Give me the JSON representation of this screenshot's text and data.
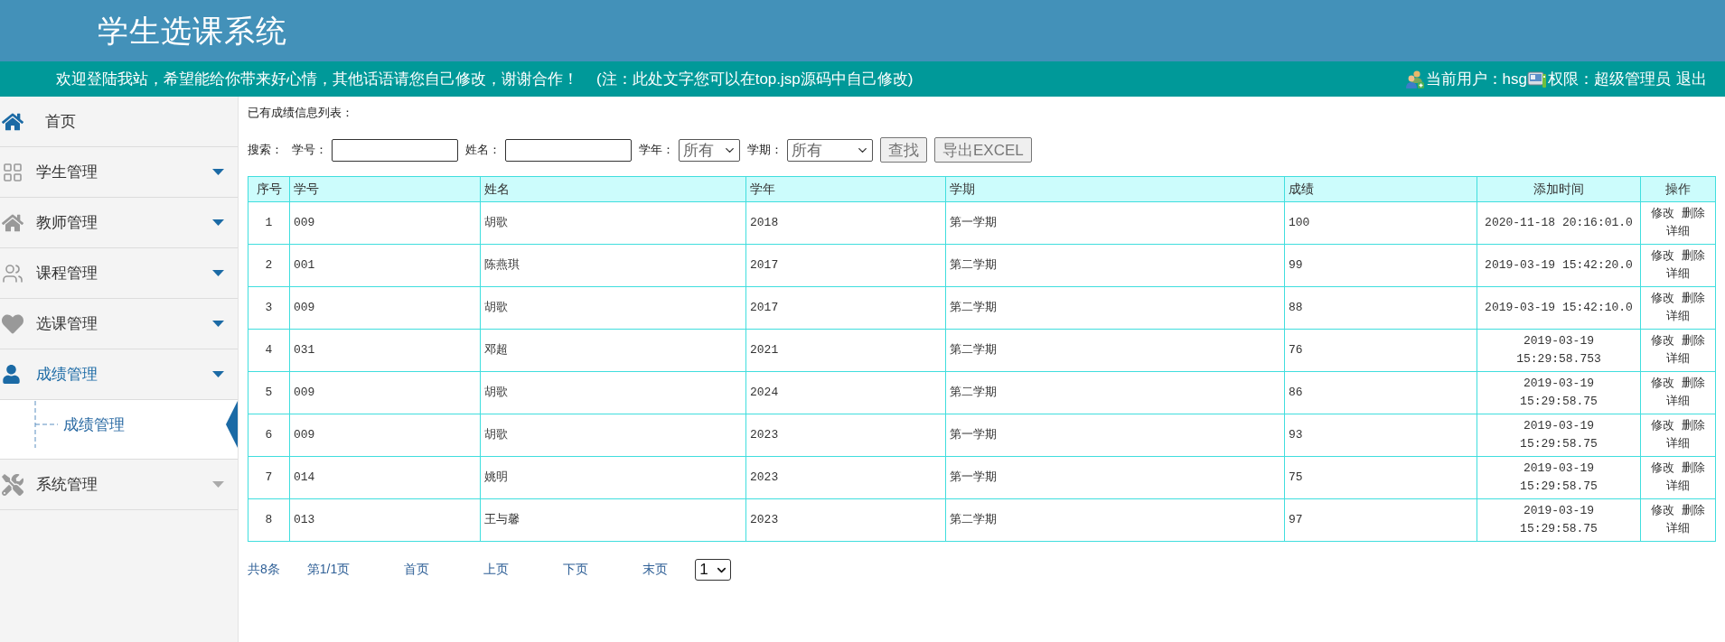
{
  "header": {
    "title": "学生选课系统"
  },
  "top_bar": {
    "welcome": "欢迎登陆我站，希望能给你带来好心情，其他话语请您自己修改，谢谢合作！",
    "note": "(注：此处文字您可以在top.jsp源码中自己修改)",
    "current_user": "当前用户：hsg",
    "role": "权限：超级管理员",
    "logout": "退出"
  },
  "sidebar": {
    "items": [
      {
        "label": "首页",
        "kind": "link",
        "selected": false
      },
      {
        "label": "学生管理",
        "kind": "menu",
        "selected": false,
        "caret_muted": false
      },
      {
        "label": "教师管理",
        "kind": "menu",
        "selected": false,
        "caret_muted": false
      },
      {
        "label": "课程管理",
        "kind": "menu",
        "selected": false,
        "caret_muted": false
      },
      {
        "label": "选课管理",
        "kind": "menu",
        "selected": false,
        "caret_muted": false
      },
      {
        "label": "成绩管理",
        "kind": "menu",
        "selected": true,
        "caret_muted": false,
        "children": [
          {
            "label": "成绩管理",
            "selected": true
          }
        ]
      },
      {
        "label": "系统管理",
        "kind": "menu",
        "selected": false,
        "caret_muted": true
      }
    ]
  },
  "content": {
    "heading": "已有成绩信息列表：",
    "search": {
      "label": "搜索：",
      "fields": [
        {
          "label": "学号：",
          "kind": "input"
        },
        {
          "label": "姓名：",
          "kind": "input"
        },
        {
          "label": "学年：",
          "kind": "select",
          "value": "所有"
        },
        {
          "label": "学期：",
          "kind": "select",
          "value": "所有"
        }
      ],
      "buttons": [
        "查找",
        "导出EXCEL"
      ]
    },
    "table": {
      "columns": [
        "序号",
        "学号",
        "姓名",
        "学年",
        "学期",
        "成绩",
        "添加时间",
        "操作"
      ],
      "rows": [
        {
          "cells": [
            "1",
            "009",
            "胡歌",
            "2018",
            "第一学期",
            "100",
            "2020-11-18 20:16:01.0"
          ],
          "actions": [
            "修改",
            "删除",
            "详细"
          ]
        },
        {
          "cells": [
            "2",
            "001",
            "陈燕琪",
            "2017",
            "第二学期",
            "99",
            "2019-03-19 15:42:20.0"
          ],
          "actions": [
            "修改",
            "删除",
            "详细"
          ]
        },
        {
          "cells": [
            "3",
            "009",
            "胡歌",
            "2017",
            "第二学期",
            "88",
            "2019-03-19 15:42:10.0"
          ],
          "actions": [
            "修改",
            "删除",
            "详细"
          ]
        },
        {
          "cells": [
            "4",
            "031",
            "邓超",
            "2021",
            "第二学期",
            "76",
            "2019-03-19 15:29:58.753"
          ],
          "actions": [
            "修改",
            "删除",
            "详细"
          ]
        },
        {
          "cells": [
            "5",
            "009",
            "胡歌",
            "2024",
            "第二学期",
            "86",
            "2019-03-19 15:29:58.75"
          ],
          "actions": [
            "修改",
            "删除",
            "详细"
          ]
        },
        {
          "cells": [
            "6",
            "009",
            "胡歌",
            "2023",
            "第一学期",
            "93",
            "2019-03-19 15:29:58.75"
          ],
          "actions": [
            "修改",
            "删除",
            "详细"
          ]
        },
        {
          "cells": [
            "7",
            "014",
            "姚明",
            "2023",
            "第一学期",
            "75",
            "2019-03-19 15:29:58.75"
          ],
          "actions": [
            "修改",
            "删除",
            "详细"
          ]
        },
        {
          "cells": [
            "8",
            "013",
            "王与馨",
            "2023",
            "第二学期",
            "97",
            "2019-03-19 15:29:58.75"
          ],
          "actions": [
            "修改",
            "删除",
            "详细"
          ]
        }
      ]
    },
    "pagination": {
      "total": "共8条",
      "page": "第1/1页",
      "links": [
        "首页",
        "上页",
        "下页",
        "末页"
      ],
      "page_select": "1"
    }
  }
}
